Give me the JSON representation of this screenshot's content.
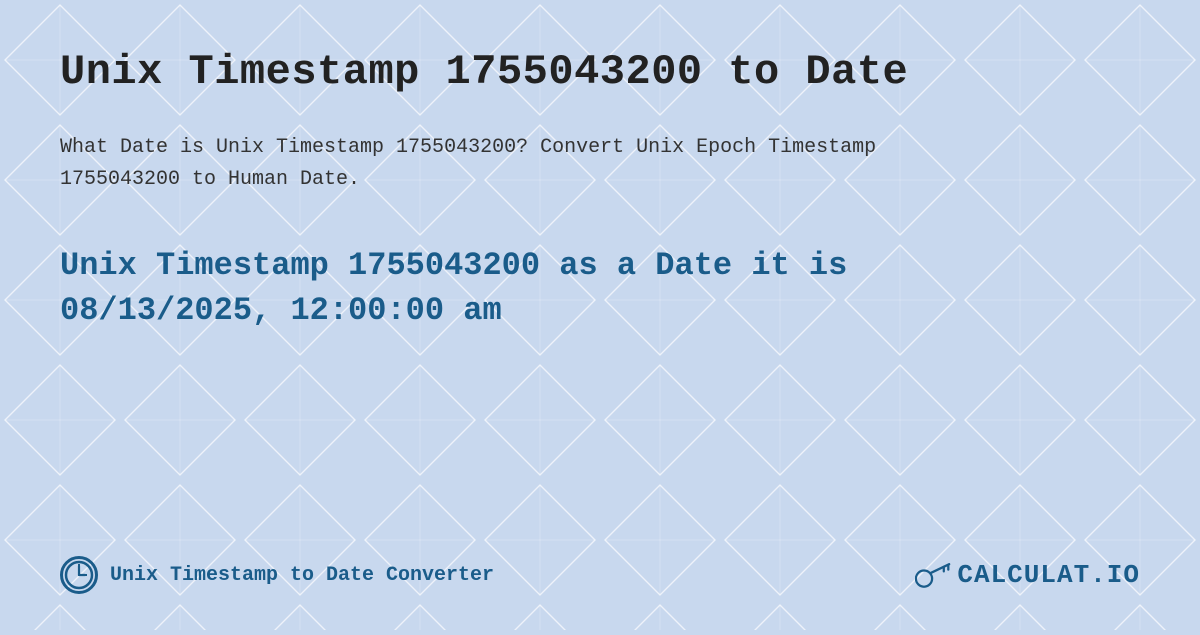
{
  "page": {
    "title": "Unix Timestamp 1755043200 to Date",
    "description": "What Date is Unix Timestamp 1755043200? Convert Unix Epoch Timestamp 1755043200 to Human Date.",
    "result_line1": "Unix Timestamp 1755043200 as a Date it is",
    "result_line2": "08/13/2025, 12:00:00 am",
    "footer_label": "Unix Timestamp to Date Converter",
    "logo_text": "CALCULAT.IO"
  },
  "colors": {
    "background": "#c8d8ee",
    "title": "#222222",
    "description": "#333333",
    "accent": "#1a5c8a"
  }
}
